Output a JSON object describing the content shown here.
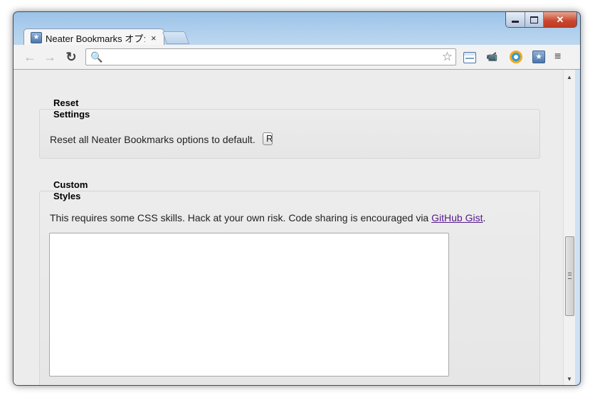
{
  "window": {
    "caption_buttons": {
      "close_label": "✕"
    }
  },
  "tab": {
    "favicon": "bookmark-star-icon",
    "title": "Neater Bookmarks オプション",
    "close_label": "×"
  },
  "toolbar": {
    "back": "←",
    "forward": "→",
    "reload": "↻",
    "search_glyph": "🔍",
    "url": "",
    "star": "☆",
    "menu": "≡",
    "camera_glyph": "📹",
    "bookmark_glyph": "★"
  },
  "reset_section": {
    "legend_line1": "Reset",
    "legend_line2": "Settings",
    "description": "Reset all Neater Bookmarks options to default.",
    "button_label": "R"
  },
  "custom_styles_section": {
    "legend_line1": "Custom",
    "legend_line2": "Styles",
    "description": "This requires some CSS skills. Hack at your own risk. Code sharing is encouraged via ",
    "link_text": "GitHub Gist",
    "description_end": ".",
    "textarea_value": ""
  },
  "scrollbar": {
    "up": "▲",
    "down": "▼"
  }
}
